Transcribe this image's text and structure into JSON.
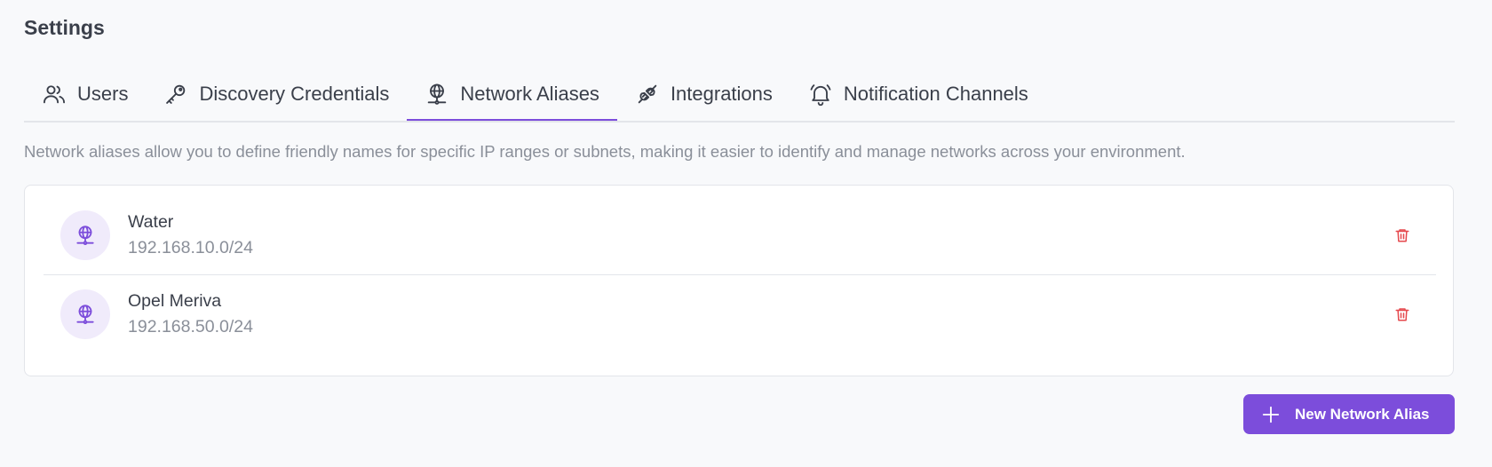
{
  "page": {
    "title": "Settings",
    "description": "Network aliases allow you to define friendly names for specific IP ranges or subnets, making it easier to identify and manage networks across your environment."
  },
  "tabs": [
    {
      "label": "Users",
      "icon": "users-icon",
      "active": false
    },
    {
      "label": "Discovery Credentials",
      "icon": "key-icon",
      "active": false
    },
    {
      "label": "Network Aliases",
      "icon": "network-globe-icon",
      "active": true
    },
    {
      "label": "Integrations",
      "icon": "plug-icon",
      "active": false
    },
    {
      "label": "Notification Channels",
      "icon": "bell-icon",
      "active": false
    }
  ],
  "aliases": [
    {
      "name": "Water",
      "subnet": "192.168.10.0/24",
      "icon": "network-globe-icon"
    },
    {
      "name": "Opel Meriva",
      "subnet": "192.168.50.0/24",
      "icon": "network-globe-icon"
    }
  ],
  "actions": {
    "new_alias_label": "New Network Alias"
  },
  "colors": {
    "accent": "#7c4ddb",
    "delete": "#e5484d",
    "avatar_bg": "#f0ebfb"
  }
}
